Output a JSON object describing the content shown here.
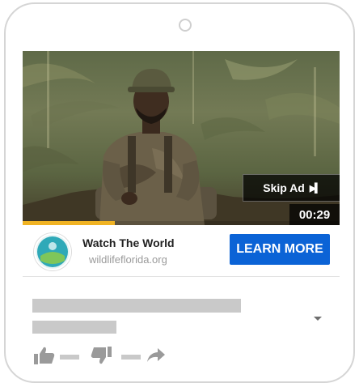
{
  "player": {
    "skip_label": "Skip Ad",
    "time_remaining": "00:29",
    "progress": 0.29
  },
  "ad": {
    "title": "Watch The World",
    "url": "wildlifeflorida.org",
    "cta_label": "LEARN MORE",
    "cta_color": "#0b63d6",
    "progress_color": "#f0b323"
  },
  "actions": {
    "like_icon": "thumbs-up-icon",
    "dislike_icon": "thumbs-down-icon",
    "share_icon": "share-arrow-icon",
    "menu_icon": "chevron-down-icon"
  }
}
